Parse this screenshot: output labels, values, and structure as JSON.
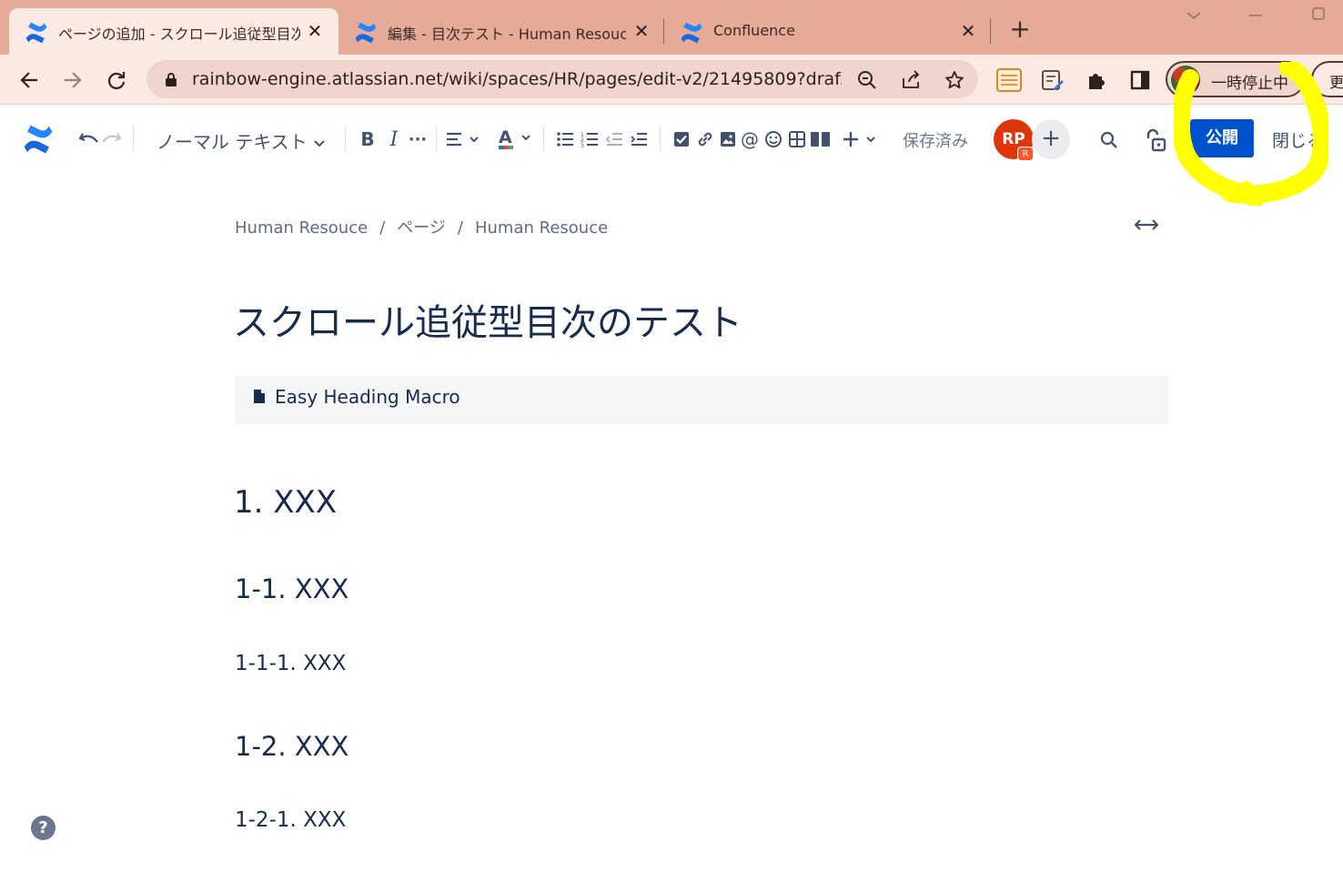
{
  "browser": {
    "tabs": [
      {
        "title": "ページの追加 - スクロール追従型目次のテスト",
        "close": "✕",
        "active": true
      },
      {
        "title": "編集 - 目次テスト - Human Resouce",
        "close": "✕",
        "active": false
      },
      {
        "title": "Confluence",
        "close": "✕",
        "active": false
      }
    ],
    "url": "rainbow-engine.atlassian.net/wiki/spaces/HR/pages/edit-v2/21495809?draf...",
    "profile_label": "一時停止中",
    "update_label": "更"
  },
  "toolbar": {
    "text_style": "ノーマル テキスト",
    "saved_status": "保存済み",
    "avatar_initials": "RP",
    "avatar_badge": "R",
    "publish_label": "公開",
    "close_label": "閉じる"
  },
  "page": {
    "breadcrumb": [
      "Human Resouce",
      "ページ",
      "Human Resouce"
    ],
    "breadcrumb_sep": "/",
    "title": "スクロール追従型目次のテスト",
    "macro_label": "Easy Heading Macro",
    "headings": [
      {
        "level": 1,
        "text": "1. XXX"
      },
      {
        "level": 2,
        "text": "1-1. XXX"
      },
      {
        "level": 3,
        "text": "1-1-1. XXX"
      },
      {
        "level": 2,
        "text": "1-2. XXX"
      },
      {
        "level": 3,
        "text": "1-2-1. XXX"
      }
    ]
  },
  "help_label": "?",
  "colors": {
    "tabstrip": "#e6ab98",
    "toolbar_bg": "#fbe9e3",
    "brand_blue": "#0052cc",
    "highlight": "#ffff00",
    "avatar": "#de350b"
  }
}
